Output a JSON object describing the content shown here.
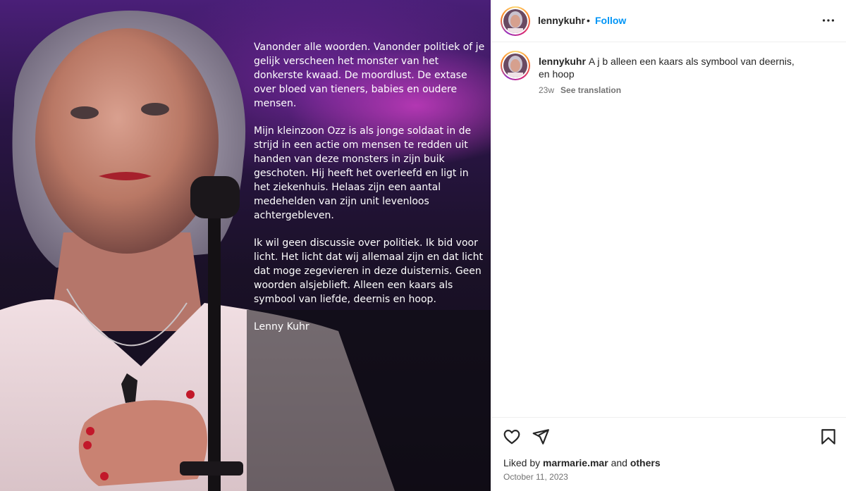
{
  "post": {
    "overlay_paragraphs": [
      "Vanonder alle woorden. Vanonder politiek of je gelijk verscheen het monster van het donkerste kwaad. De moordlust. De extase over bloed van tieners, babies en oudere mensen.",
      "Mijn kleinzoon Ozz is als jonge soldaat in de strijd in een actie om mensen te redden uit handen van deze monsters in zijn buik geschoten. Hij heeft het overleefd en ligt in het ziekenhuis. Helaas zijn een aantal medehelden van zijn unit levenloos achtergebleven.",
      "Ik wil geen discussie over politiek. Ik bid voor licht. Het licht dat wij allemaal zijn en dat licht dat moge zegevieren in deze duisternis. Geen woorden alsjeblieft. Alleen een kaars als symbool van liefde, deernis en hoop.",
      "Lenny Kuhr"
    ]
  },
  "header": {
    "username": "lennykuhr",
    "separator": "•",
    "follow_label": "Follow",
    "more_icon": "more-horizontal-icon"
  },
  "caption": {
    "username": "lennykuhr",
    "text": "A j b alleen een kaars als symbool van deernis, en hoop",
    "age": "23w",
    "translate_label": "See translation"
  },
  "actions": {
    "like_icon": "heart-icon",
    "share_icon": "send-icon",
    "save_icon": "bookmark-icon",
    "liked_prefix": "Liked by",
    "liked_user": "marmarie.mar",
    "liked_and": "and",
    "liked_others": "others",
    "date": "October 11, 2023"
  },
  "colors": {
    "follow_blue": "#0095f6",
    "stage_purple": "#4a1f78",
    "text_secondary": "#737373"
  }
}
